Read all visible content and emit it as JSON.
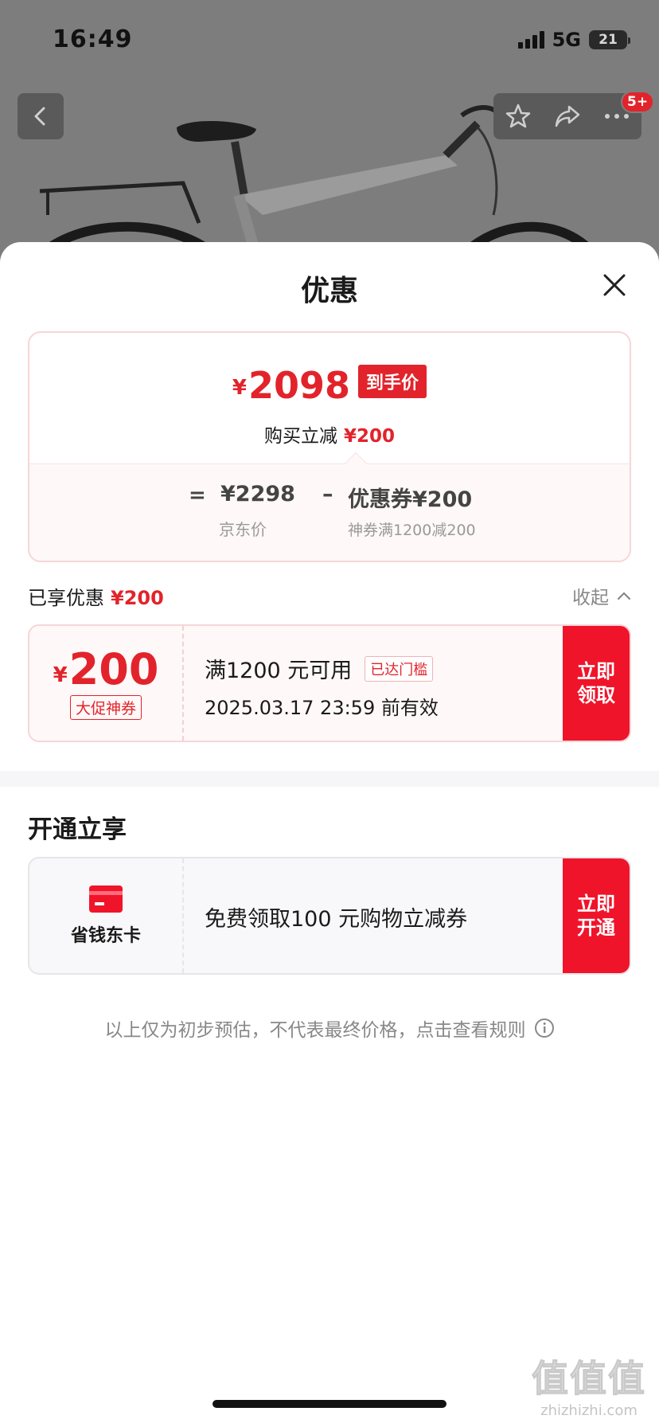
{
  "status_bar": {
    "time": "16:49",
    "network": "5G",
    "battery": "21"
  },
  "nav": {
    "cart_badge": "5+",
    "icons": [
      "back-icon",
      "star-icon",
      "share-icon",
      "more-icon"
    ]
  },
  "sheet": {
    "title": "优惠"
  },
  "price_card": {
    "currency": "¥",
    "final_price": "2098",
    "final_tag": "到手价",
    "reduce_label": "购买立减",
    "reduce_value": "¥200",
    "equals": "=",
    "jd_price": "¥2298",
    "minus": "–",
    "coupon_label": "优惠券¥200",
    "jd_price_label": "京东价",
    "coupon_sub": "神券满1200减200"
  },
  "enjoyed": {
    "label": "已享优惠",
    "value": "¥200",
    "collapse_label": "收起"
  },
  "coupon": {
    "currency": "¥",
    "amount": "200",
    "tag": "大促神券",
    "condition": "满1200 元可用",
    "chip": "已达门槛",
    "expiry": "2025.03.17 23:59 前有效",
    "button_line1": "立即",
    "button_line2": "领取"
  },
  "member_section": {
    "title": "开通立享",
    "card_name": "省钱东卡",
    "text": "免费领取100 元购物立减券",
    "button_line1": "立即",
    "button_line2": "开通"
  },
  "disclaimer": "以上仅为初步预估，不代表最终价格，点击查看规则",
  "watermark": {
    "big": "值值值",
    "small": "zhizhizhi.com"
  },
  "colors": {
    "accent": "#e2232b",
    "button": "#f0142a"
  }
}
